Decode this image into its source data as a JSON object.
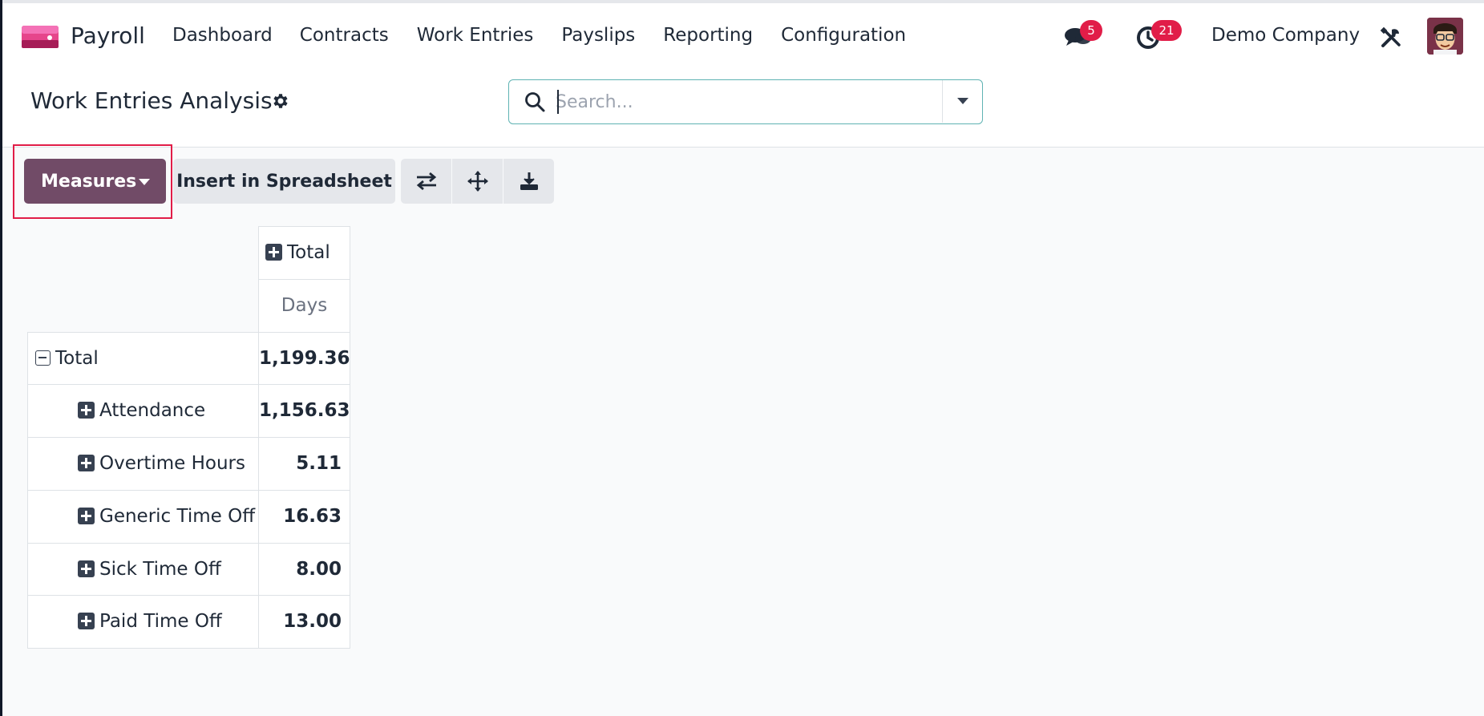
{
  "navbar": {
    "app_name": "Payroll",
    "menu": [
      "Dashboard",
      "Contracts",
      "Work Entries",
      "Payslips",
      "Reporting",
      "Configuration"
    ],
    "messages_count": "5",
    "activities_count": "21",
    "company": "Demo Company"
  },
  "control": {
    "title": "Work Entries Analysis",
    "search_placeholder": "Search..."
  },
  "toolbar": {
    "measures_label": "Measures",
    "insert_label": "Insert in Spreadsheet"
  },
  "pivot": {
    "col_header": "Total",
    "measure": "Days",
    "row_total_label": "Total",
    "row_total_value": "1,199.36",
    "rows": [
      {
        "label": "Attendance",
        "value": "1,156.63"
      },
      {
        "label": "Overtime Hours",
        "value": "5.11"
      },
      {
        "label": "Generic Time Off",
        "value": "16.63"
      },
      {
        "label": "Sick Time Off",
        "value": "8.00"
      },
      {
        "label": "Paid Time Off",
        "value": "13.00"
      }
    ]
  },
  "colors": {
    "primary": "#714b67",
    "badge": "#e11d48",
    "highlight": "#e11d48"
  }
}
